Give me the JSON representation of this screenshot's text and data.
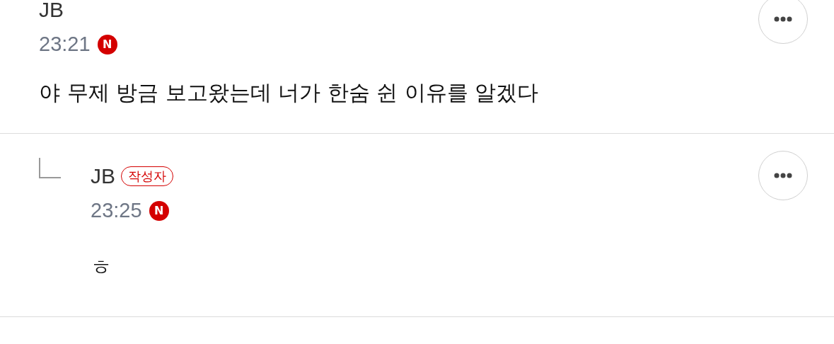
{
  "comments": [
    {
      "kind": "comment",
      "author": "JB",
      "time": "23:21",
      "new_badge": "N",
      "text": "야 무제 방금 보고왔는데 너가 한숨 쉰 이유를 알겠다"
    },
    {
      "kind": "reply",
      "author": "JB",
      "author_badge": "작성자",
      "time": "23:25",
      "new_badge": "N",
      "text": "ㅎ"
    }
  ]
}
